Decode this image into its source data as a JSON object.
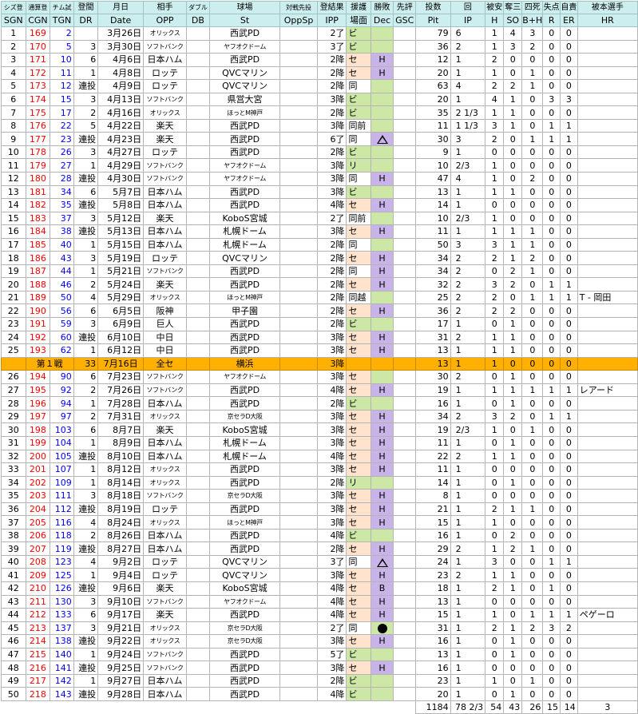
{
  "header": {
    "row1": [
      "シズ登",
      "通算登",
      "チム試",
      "登間",
      "月日",
      "相手",
      "ダブル",
      "球場",
      "対戦先投",
      "登結果",
      "援護",
      "勝敗",
      "先評",
      "投数",
      "回",
      "被安",
      "奪三",
      "四死",
      "失点",
      "自責",
      "被本選手"
    ],
    "row2": [
      "SGN",
      "CGN",
      "TGN",
      "DR",
      "Date",
      "OPP",
      "DB",
      "St",
      "OppSp",
      "IPP",
      "場面",
      "Dec",
      "GSC",
      "Pit",
      "IP",
      "H",
      "SO",
      "B+H",
      "R",
      "ER",
      "HR"
    ]
  },
  "dec_legend": {
    "circle": "win",
    "triangle": "loss",
    "filled": "filled-circle"
  },
  "colors": {
    "header_bg": "#cdeeee",
    "allstar_bg": "#ffb000",
    "pink": "#ffe3cc",
    "green": "#cde8a6",
    "purple": "#c8b4e8"
  },
  "rows": [
    {
      "sgn": "1",
      "cgn": "169",
      "tgn": "2",
      "dr": "",
      "date": "3月26日",
      "opp": "オリックス",
      "st": "西武PD",
      "ipp": "2了",
      "bam": "ビ",
      "dec": "circle",
      "pit": "79",
      "ip": "6",
      "h": "1",
      "so": "4",
      "bh": "3",
      "r": "0",
      "er": "0",
      "hr": ""
    },
    {
      "sgn": "2",
      "cgn": "170",
      "tgn": "5",
      "dr": "3",
      "date": "3月30日",
      "opp": "ソフトバンク",
      "st": "ヤフオクドーム",
      "ipp": "3了",
      "bam": "ビ",
      "dec": "",
      "pit": "36",
      "ip": "2",
      "h": "1",
      "so": "3",
      "bh": "2",
      "r": "0",
      "er": "0",
      "hr": ""
    },
    {
      "sgn": "3",
      "cgn": "171",
      "tgn": "10",
      "dr": "6",
      "date": "4月6日",
      "opp": "日本ハム",
      "st": "西武PD",
      "ipp": "2降",
      "bam": "セ",
      "dec": "H",
      "pit": "12",
      "ip": "1",
      "h": "2",
      "so": "0",
      "bh": "0",
      "r": "0",
      "er": "0",
      "hr": ""
    },
    {
      "sgn": "4",
      "cgn": "172",
      "tgn": "11",
      "dr": "1",
      "date": "4月8日",
      "opp": "ロッテ",
      "st": "QVCマリン",
      "ipp": "2降",
      "bam": "セ",
      "dec": "H",
      "pit": "20",
      "ip": "1",
      "h": "1",
      "so": "0",
      "bh": "1",
      "r": "0",
      "er": "0",
      "hr": ""
    },
    {
      "sgn": "5",
      "cgn": "173",
      "tgn": "12",
      "dr": "連投",
      "date": "4月9日",
      "opp": "ロッテ",
      "st": "QVCマリン",
      "ipp": "2降",
      "bam": "同",
      "dec": "circle",
      "pit": "63",
      "ip": "4",
      "h": "2",
      "so": "2",
      "bh": "1",
      "r": "0",
      "er": "0",
      "hr": ""
    },
    {
      "sgn": "6",
      "cgn": "174",
      "tgn": "15",
      "dr": "3",
      "date": "4月13日",
      "opp": "ソフトバンク",
      "st": "県営大宮",
      "ipp": "3降",
      "bam": "ビ",
      "dec": "",
      "pit": "20",
      "ip": "1",
      "h": "4",
      "so": "1",
      "bh": "0",
      "r": "3",
      "er": "3",
      "hr": ""
    },
    {
      "sgn": "7",
      "cgn": "175",
      "tgn": "17",
      "dr": "2",
      "date": "4月16日",
      "opp": "オリックス",
      "st": "ほっとM神戸",
      "ipp": "2降",
      "bam": "ビ",
      "dec": "circle",
      "pit": "35",
      "ip": "2 1/3",
      "h": "1",
      "so": "1",
      "bh": "0",
      "r": "0",
      "er": "0",
      "hr": ""
    },
    {
      "sgn": "8",
      "cgn": "176",
      "tgn": "22",
      "dr": "5",
      "date": "4月22日",
      "opp": "楽天",
      "st": "西武PD",
      "ipp": "3降",
      "bam": "同前",
      "dec": "",
      "pit": "11",
      "ip": "1 1/3",
      "h": "3",
      "so": "1",
      "bh": "0",
      "r": "1",
      "er": "1",
      "hr": ""
    },
    {
      "sgn": "9",
      "cgn": "177",
      "tgn": "23",
      "dr": "連投",
      "date": "4月23日",
      "opp": "楽天",
      "st": "西武PD",
      "ipp": "6了",
      "bam": "同",
      "dec": "tri",
      "pit": "30",
      "ip": "3",
      "h": "2",
      "so": "0",
      "bh": "1",
      "r": "1",
      "er": "1",
      "hr": ""
    },
    {
      "sgn": "10",
      "cgn": "178",
      "tgn": "26",
      "dr": "3",
      "date": "4月27日",
      "opp": "ロッテ",
      "st": "西武PD",
      "ipp": "2降",
      "bam": "ビ",
      "dec": "",
      "pit": "9",
      "ip": "1",
      "h": "0",
      "so": "0",
      "bh": "0",
      "r": "0",
      "er": "0",
      "hr": ""
    },
    {
      "sgn": "11",
      "cgn": "179",
      "tgn": "27",
      "dr": "1",
      "date": "4月29日",
      "opp": "ソフトバンク",
      "st": "ヤフオクドーム",
      "ipp": "3降",
      "bam": "リ",
      "dec": "",
      "pit": "10",
      "ip": "2/3",
      "h": "1",
      "so": "0",
      "bh": "0",
      "r": "0",
      "er": "0",
      "hr": ""
    },
    {
      "sgn": "12",
      "cgn": "180",
      "tgn": "28",
      "dr": "連投",
      "date": "4月30日",
      "opp": "ソフトバンク",
      "st": "ヤフオクドーム",
      "ipp": "3降",
      "bam": "同",
      "dec": "H",
      "pit": "47",
      "ip": "4",
      "h": "1",
      "so": "0",
      "bh": "2",
      "r": "0",
      "er": "0",
      "hr": ""
    },
    {
      "sgn": "13",
      "cgn": "181",
      "tgn": "34",
      "dr": "6",
      "date": "5月7日",
      "opp": "日本ハム",
      "st": "西武PD",
      "ipp": "3降",
      "bam": "ビ",
      "dec": "",
      "pit": "13",
      "ip": "1",
      "h": "1",
      "so": "1",
      "bh": "0",
      "r": "0",
      "er": "0",
      "hr": ""
    },
    {
      "sgn": "14",
      "cgn": "182",
      "tgn": "35",
      "dr": "連投",
      "date": "5月8日",
      "opp": "日本ハム",
      "st": "西武PD",
      "ipp": "4降",
      "bam": "セ",
      "dec": "H",
      "pit": "14",
      "ip": "1",
      "h": "0",
      "so": "0",
      "bh": "0",
      "r": "0",
      "er": "0",
      "hr": ""
    },
    {
      "sgn": "15",
      "cgn": "183",
      "tgn": "37",
      "dr": "3",
      "date": "5月12日",
      "opp": "楽天",
      "st": "KoboS宮城",
      "ipp": "2了",
      "bam": "同前",
      "dec": "",
      "pit": "10",
      "ip": "2/3",
      "h": "1",
      "so": "0",
      "bh": "0",
      "r": "0",
      "er": "0",
      "hr": ""
    },
    {
      "sgn": "16",
      "cgn": "184",
      "tgn": "38",
      "dr": "連投",
      "date": "5月13日",
      "opp": "日本ハム",
      "st": "札幌ドーム",
      "ipp": "3降",
      "bam": "セ",
      "dec": "H",
      "pit": "11",
      "ip": "1",
      "h": "1",
      "so": "1",
      "bh": "1",
      "r": "0",
      "er": "0",
      "hr": ""
    },
    {
      "sgn": "17",
      "cgn": "185",
      "tgn": "40",
      "dr": "1",
      "date": "5月15日",
      "opp": "日本ハム",
      "st": "札幌ドーム",
      "ipp": "2降",
      "bam": "同",
      "dec": "circle",
      "pit": "50",
      "ip": "3",
      "h": "3",
      "so": "1",
      "bh": "1",
      "r": "0",
      "er": "0",
      "hr": ""
    },
    {
      "sgn": "18",
      "cgn": "186",
      "tgn": "43",
      "dr": "3",
      "date": "5月19日",
      "opp": "ロッテ",
      "st": "QVCマリン",
      "ipp": "2降",
      "bam": "セ",
      "dec": "H",
      "pit": "34",
      "ip": "2",
      "h": "2",
      "so": "1",
      "bh": "2",
      "r": "0",
      "er": "0",
      "hr": ""
    },
    {
      "sgn": "19",
      "cgn": "187",
      "tgn": "44",
      "dr": "1",
      "date": "5月21日",
      "opp": "ソフトバンク",
      "st": "西武PD",
      "ipp": "2降",
      "bam": "同",
      "dec": "H",
      "pit": "34",
      "ip": "2",
      "h": "0",
      "so": "2",
      "bh": "1",
      "r": "0",
      "er": "0",
      "hr": ""
    },
    {
      "sgn": "20",
      "cgn": "188",
      "tgn": "46",
      "dr": "2",
      "date": "5月24日",
      "opp": "楽天",
      "st": "西武PD",
      "ipp": "2降",
      "bam": "セ",
      "dec": "H",
      "pit": "32",
      "ip": "2",
      "h": "3",
      "so": "2",
      "bh": "0",
      "r": "1",
      "er": "1",
      "hr": ""
    },
    {
      "sgn": "21",
      "cgn": "189",
      "tgn": "50",
      "dr": "4",
      "date": "5月29日",
      "opp": "オリックス",
      "st": "ほっとM神戸",
      "ipp": "2降",
      "bam": "同越",
      "dec": "circle",
      "pit": "25",
      "ip": "2",
      "h": "2",
      "so": "0",
      "bh": "1",
      "r": "1",
      "er": "1",
      "hr": "T - 岡田"
    },
    {
      "sgn": "22",
      "cgn": "190",
      "tgn": "56",
      "dr": "6",
      "date": "6月5日",
      "opp": "阪神",
      "st": "甲子園",
      "ipp": "2降",
      "bam": "セ",
      "dec": "H",
      "pit": "36",
      "ip": "2",
      "h": "2",
      "so": "2",
      "bh": "0",
      "r": "0",
      "er": "0",
      "hr": ""
    },
    {
      "sgn": "23",
      "cgn": "191",
      "tgn": "59",
      "dr": "3",
      "date": "6月9日",
      "opp": "巨人",
      "st": "西武PD",
      "ipp": "2降",
      "bam": "ビ",
      "dec": "circle",
      "pit": "17",
      "ip": "1",
      "h": "0",
      "so": "1",
      "bh": "0",
      "r": "0",
      "er": "0",
      "hr": ""
    },
    {
      "sgn": "24",
      "cgn": "192",
      "tgn": "60",
      "dr": "連投",
      "date": "6月10日",
      "opp": "中日",
      "st": "西武PD",
      "ipp": "3降",
      "bam": "セ",
      "dec": "H",
      "pit": "31",
      "ip": "2",
      "h": "1",
      "so": "1",
      "bh": "0",
      "r": "0",
      "er": "0",
      "hr": ""
    },
    {
      "sgn": "25",
      "cgn": "193",
      "tgn": "62",
      "dr": "1",
      "date": "6月12日",
      "opp": "中日",
      "st": "西武PD",
      "ipp": "3降",
      "bam": "セ",
      "dec": "H",
      "pit": "13",
      "ip": "1",
      "h": "1",
      "so": "1",
      "bh": "0",
      "r": "0",
      "er": "0",
      "hr": ""
    }
  ],
  "allstar": {
    "label": "第１戦",
    "tgn": "33",
    "date": "7月16日",
    "opp": "全セ",
    "st": "横浜",
    "ipp": "3降",
    "pit": "13",
    "ip": "1",
    "h": "1",
    "so": "0",
    "bh": "0",
    "r": "0",
    "er": "0"
  },
  "rows2": [
    {
      "sgn": "26",
      "cgn": "194",
      "tgn": "90",
      "dr": "6",
      "date": "7月23日",
      "opp": "ソフトバンク",
      "st": "ヤフオクドーム",
      "ipp": "3降",
      "bam": "セ",
      "dec": "circle",
      "pit": "30",
      "ip": "2",
      "h": "0",
      "so": "1",
      "bh": "0",
      "r": "0",
      "er": "0",
      "hr": ""
    },
    {
      "sgn": "27",
      "cgn": "195",
      "tgn": "92",
      "dr": "2",
      "date": "7月26日",
      "opp": "ソフトバンク",
      "st": "西武PD",
      "ipp": "4降",
      "bam": "セ",
      "dec": "H",
      "pit": "19",
      "ip": "1",
      "h": "1",
      "so": "1",
      "bh": "1",
      "r": "1",
      "er": "1",
      "hr": "レアード"
    },
    {
      "sgn": "28",
      "cgn": "196",
      "tgn": "94",
      "dr": "1",
      "date": "7月28日",
      "opp": "日本ハム",
      "st": "西武PD",
      "ipp": "2降",
      "bam": "ビ",
      "dec": "",
      "pit": "16",
      "ip": "1",
      "h": "0",
      "so": "1",
      "bh": "0",
      "r": "0",
      "er": "0",
      "hr": ""
    },
    {
      "sgn": "29",
      "cgn": "197",
      "tgn": "97",
      "dr": "2",
      "date": "7月31日",
      "opp": "オリックス",
      "st": "京セラD大阪",
      "ipp": "3降",
      "bam": "セ",
      "dec": "H",
      "pit": "34",
      "ip": "2",
      "h": "3",
      "so": "2",
      "bh": "0",
      "r": "1",
      "er": "1",
      "hr": ""
    },
    {
      "sgn": "30",
      "cgn": "198",
      "tgn": "103",
      "dr": "6",
      "date": "8月7日",
      "opp": "楽天",
      "st": "KoboS宮城",
      "ipp": "3降",
      "bam": "セ",
      "dec": "H",
      "pit": "19",
      "ip": "2/3",
      "h": "1",
      "so": "0",
      "bh": "1",
      "r": "0",
      "er": "0",
      "hr": ""
    },
    {
      "sgn": "31",
      "cgn": "199",
      "tgn": "104",
      "dr": "1",
      "date": "8月9日",
      "opp": "日本ハム",
      "st": "札幌ドーム",
      "ipp": "3降",
      "bam": "セ",
      "dec": "H",
      "pit": "11",
      "ip": "1",
      "h": "0",
      "so": "1",
      "bh": "0",
      "r": "0",
      "er": "0",
      "hr": ""
    },
    {
      "sgn": "32",
      "cgn": "200",
      "tgn": "105",
      "dr": "連投",
      "date": "8月10日",
      "opp": "日本ハム",
      "st": "札幌ドーム",
      "ipp": "4降",
      "bam": "セ",
      "dec": "H",
      "pit": "22",
      "ip": "2",
      "h": "1",
      "so": "1",
      "bh": "0",
      "r": "0",
      "er": "0",
      "hr": ""
    },
    {
      "sgn": "33",
      "cgn": "201",
      "tgn": "107",
      "dr": "1",
      "date": "8月12日",
      "opp": "オリックス",
      "st": "西武PD",
      "ipp": "3降",
      "bam": "セ",
      "dec": "H",
      "pit": "11",
      "ip": "1",
      "h": "0",
      "so": "0",
      "bh": "0",
      "r": "0",
      "er": "0",
      "hr": ""
    },
    {
      "sgn": "34",
      "cgn": "202",
      "tgn": "109",
      "dr": "1",
      "date": "8月14日",
      "opp": "オリックス",
      "st": "西武PD",
      "ipp": "2降",
      "bam": "リ",
      "dec": "",
      "pit": "14",
      "ip": "1",
      "h": "0",
      "so": "1",
      "bh": "0",
      "r": "0",
      "er": "0",
      "hr": ""
    },
    {
      "sgn": "35",
      "cgn": "203",
      "tgn": "111",
      "dr": "3",
      "date": "8月18日",
      "opp": "ソフトバンク",
      "st": "京セラD大阪",
      "ipp": "3降",
      "bam": "セ",
      "dec": "H",
      "pit": "8",
      "ip": "1",
      "h": "0",
      "so": "0",
      "bh": "0",
      "r": "0",
      "er": "0",
      "hr": ""
    },
    {
      "sgn": "36",
      "cgn": "204",
      "tgn": "112",
      "dr": "連投",
      "date": "8月19日",
      "opp": "ロッテ",
      "st": "西武PD",
      "ipp": "3降",
      "bam": "セ",
      "dec": "H",
      "pit": "21",
      "ip": "1",
      "h": "2",
      "so": "1",
      "bh": "1",
      "r": "0",
      "er": "0",
      "hr": ""
    },
    {
      "sgn": "37",
      "cgn": "205",
      "tgn": "116",
      "dr": "4",
      "date": "8月24日",
      "opp": "オリックス",
      "st": "ほっとM神戸",
      "ipp": "3降",
      "bam": "セ",
      "dec": "H",
      "pit": "15",
      "ip": "1",
      "h": "1",
      "so": "0",
      "bh": "0",
      "r": "0",
      "er": "0",
      "hr": ""
    },
    {
      "sgn": "38",
      "cgn": "206",
      "tgn": "118",
      "dr": "2",
      "date": "8月26日",
      "opp": "日本ハム",
      "st": "西武PD",
      "ipp": "4降",
      "bam": "ビ",
      "dec": "",
      "pit": "16",
      "ip": "1",
      "h": "0",
      "so": "2",
      "bh": "0",
      "r": "0",
      "er": "0",
      "hr": ""
    },
    {
      "sgn": "39",
      "cgn": "207",
      "tgn": "119",
      "dr": "連投",
      "date": "8月27日",
      "opp": "日本ハム",
      "st": "西武PD",
      "ipp": "2降",
      "bam": "セ",
      "dec": "H",
      "pit": "29",
      "ip": "2",
      "h": "1",
      "so": "2",
      "bh": "1",
      "r": "0",
      "er": "0",
      "hr": ""
    },
    {
      "sgn": "40",
      "cgn": "208",
      "tgn": "123",
      "dr": "4",
      "date": "9月2日",
      "opp": "ロッテ",
      "st": "QVCマリン",
      "ipp": "3了",
      "bam": "同",
      "dec": "tri",
      "pit": "24",
      "ip": "1",
      "h": "3",
      "so": "0",
      "bh": "0",
      "r": "1",
      "er": "1",
      "hr": ""
    },
    {
      "sgn": "41",
      "cgn": "209",
      "tgn": "125",
      "dr": "1",
      "date": "9月4日",
      "opp": "ロッテ",
      "st": "QVCマリン",
      "ipp": "3降",
      "bam": "セ",
      "dec": "H",
      "pit": "23",
      "ip": "2",
      "h": "1",
      "so": "1",
      "bh": "0",
      "r": "0",
      "er": "0",
      "hr": ""
    },
    {
      "sgn": "42",
      "cgn": "210",
      "tgn": "126",
      "dr": "連投",
      "date": "9月6日",
      "opp": "楽天",
      "st": "KoboS宮城",
      "ipp": "4降",
      "bam": "セ",
      "dec": "B",
      "pit": "18",
      "ip": "1",
      "h": "2",
      "so": "1",
      "bh": "0",
      "r": "1",
      "er": "0",
      "hr": ""
    },
    {
      "sgn": "43",
      "cgn": "211",
      "tgn": "130",
      "dr": "3",
      "date": "9月10日",
      "opp": "ソフトバンク",
      "st": "ヤフオクドーム",
      "ipp": "4降",
      "bam": "セ",
      "dec": "H",
      "pit": "13",
      "ip": "1",
      "h": "0",
      "so": "0",
      "bh": "0",
      "r": "0",
      "er": "0",
      "hr": ""
    },
    {
      "sgn": "44",
      "cgn": "212",
      "tgn": "133",
      "dr": "6",
      "date": "9月17日",
      "opp": "楽天",
      "st": "西武PD",
      "ipp": "4降",
      "bam": "セ",
      "dec": "H",
      "pit": "15",
      "ip": "1",
      "h": "1",
      "so": "0",
      "bh": "1",
      "r": "1",
      "er": "1",
      "hr": "ペゲーロ"
    },
    {
      "sgn": "45",
      "cgn": "213",
      "tgn": "137",
      "dr": "3",
      "date": "9月21日",
      "opp": "オリックス",
      "st": "京セラD大阪",
      "ipp": "2了",
      "bam": "同",
      "dec": "fill",
      "pit": "31",
      "ip": "1",
      "h": "2",
      "so": "1",
      "bh": "2",
      "r": "3",
      "er": "2",
      "hr": ""
    },
    {
      "sgn": "46",
      "cgn": "214",
      "tgn": "138",
      "dr": "連投",
      "date": "9月22日",
      "opp": "オリックス",
      "st": "京セラD大阪",
      "ipp": "3降",
      "bam": "セ",
      "dec": "H",
      "pit": "16",
      "ip": "1",
      "h": "0",
      "so": "1",
      "bh": "0",
      "r": "0",
      "er": "0",
      "hr": ""
    },
    {
      "sgn": "47",
      "cgn": "215",
      "tgn": "140",
      "dr": "1",
      "date": "9月24日",
      "opp": "ソフトバンク",
      "st": "西武PD",
      "ipp": "5了",
      "bam": "ビ",
      "dec": "",
      "pit": "13",
      "ip": "1",
      "h": "0",
      "so": "1",
      "bh": "0",
      "r": "0",
      "er": "0",
      "hr": ""
    },
    {
      "sgn": "48",
      "cgn": "216",
      "tgn": "141",
      "dr": "連投",
      "date": "9月25日",
      "opp": "ソフトバンク",
      "st": "西武PD",
      "ipp": "3降",
      "bam": "セ",
      "dec": "H",
      "pit": "16",
      "ip": "1",
      "h": "0",
      "so": "0",
      "bh": "0",
      "r": "0",
      "er": "0",
      "hr": ""
    },
    {
      "sgn": "49",
      "cgn": "217",
      "tgn": "142",
      "dr": "1",
      "date": "9月27日",
      "opp": "日本ハム",
      "st": "西武PD",
      "ipp": "2降",
      "bam": "ビ",
      "dec": "",
      "pit": "23",
      "ip": "1",
      "h": "1",
      "so": "0",
      "bh": "1",
      "r": "0",
      "er": "0",
      "hr": ""
    },
    {
      "sgn": "50",
      "cgn": "218",
      "tgn": "143",
      "dr": "連投",
      "date": "9月28日",
      "opp": "日本ハム",
      "st": "西武PD",
      "ipp": "4降",
      "bam": "ビ",
      "dec": "",
      "pit": "20",
      "ip": "1",
      "h": "0",
      "so": "1",
      "bh": "0",
      "r": "0",
      "er": "0",
      "hr": ""
    }
  ],
  "totals": {
    "pit": "1184",
    "ip": "78 2/3",
    "h": "54",
    "so": "43",
    "bh": "26",
    "r": "15",
    "er": "14",
    "hr": "3"
  }
}
